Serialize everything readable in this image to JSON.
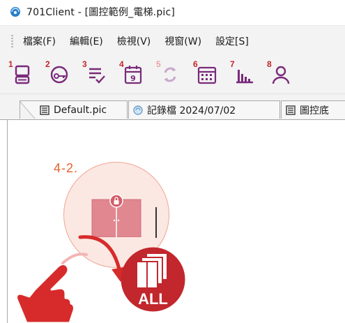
{
  "window": {
    "title": "701Client - [圖控範例_電梯.pic]",
    "icon": "app-globe-icon"
  },
  "menu": {
    "items": [
      {
        "label": "檔案(F)"
      },
      {
        "label": "編輯(E)"
      },
      {
        "label": "檢視(V)"
      },
      {
        "label": "視窗(W)"
      },
      {
        "label": "設定[S]"
      }
    ]
  },
  "toolbar": {
    "buttons": [
      {
        "num": "1",
        "icon": "terminal-computer-icon"
      },
      {
        "num": "2",
        "icon": "key-login-icon"
      },
      {
        "num": "3",
        "icon": "checklist-icon"
      },
      {
        "num": "4",
        "icon": "calendar-9-icon"
      },
      {
        "num": "5",
        "icon": "refresh-icon"
      },
      {
        "num": "6",
        "icon": "calendar-grid-icon"
      },
      {
        "num": "7",
        "icon": "bar-chart-icon"
      },
      {
        "num": "8",
        "icon": "user-icon"
      }
    ]
  },
  "tabs": [
    {
      "label": "Default.pic",
      "icon": "pic-file-icon"
    },
    {
      "label": "記錄檔 2024/07/02",
      "icon": "log-file-icon"
    },
    {
      "label": "圖控底",
      "icon": "pic-file-icon"
    }
  ],
  "canvas": {
    "step_label": "4-2.",
    "badge_text": "ALL"
  },
  "colors": {
    "accent_red": "#c1272d",
    "step_orange": "#e8602c",
    "door_pink": "#e0878f",
    "menu_bg": "#f3f3f3"
  }
}
